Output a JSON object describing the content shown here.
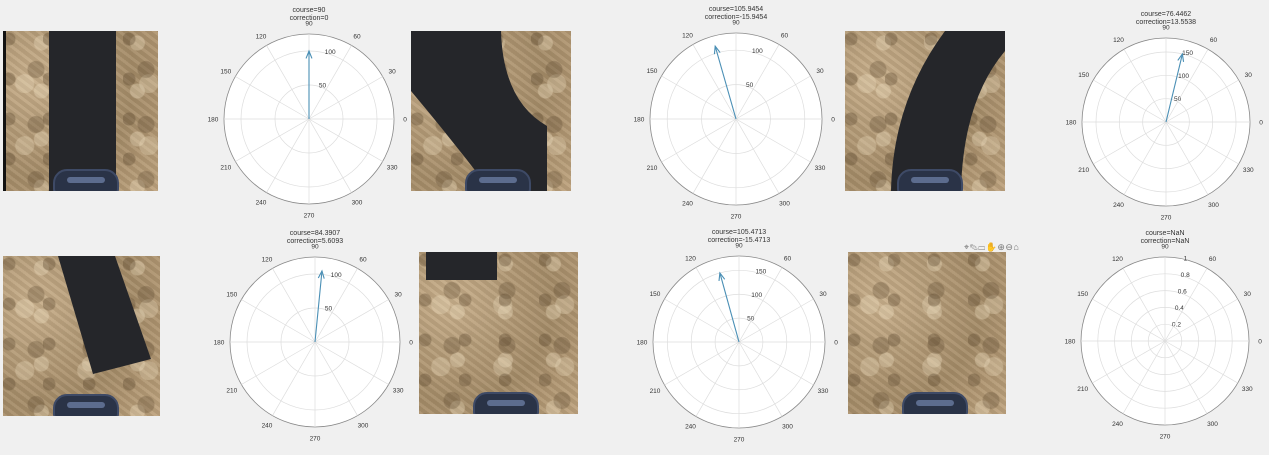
{
  "toolbar_icons": "⌖✎▭✋⊕⊖⌂",
  "plots": [
    {
      "course_label": "course=90",
      "correction_label": "correction=0",
      "radial_ticks": [
        "50",
        "100"
      ],
      "angle_deg": 90,
      "magnitude": 100,
      "rmax": 125
    },
    {
      "course_label": "course=105.9454",
      "correction_label": "correction=-15.9454",
      "radial_ticks": [
        "50",
        "100"
      ],
      "angle_deg": 105.9454,
      "magnitude": 110,
      "rmax": 125
    },
    {
      "course_label": "course=76.4462",
      "correction_label": "correction=13.5538",
      "radial_ticks": [
        "50",
        "100",
        "150"
      ],
      "angle_deg": 76.4462,
      "magnitude": 150,
      "rmax": 180
    },
    {
      "course_label": "course=84.3907",
      "correction_label": "correction=5.6093",
      "radial_ticks": [
        "50",
        "100"
      ],
      "angle_deg": 84.3907,
      "magnitude": 105,
      "rmax": 125
    },
    {
      "course_label": "course=105.4713",
      "correction_label": "correction=-15.4713",
      "radial_ticks": [
        "50",
        "100",
        "150"
      ],
      "angle_deg": 105.4713,
      "magnitude": 150,
      "rmax": 180
    },
    {
      "course_label": "course=NaN",
      "correction_label": "correction=NaN",
      "radial_ticks": [
        "0.2",
        "0.4",
        "0.6",
        "0.8",
        "1"
      ],
      "angle_deg": null,
      "magnitude": null,
      "rmax": 1
    }
  ],
  "angle_ticks": [
    "0",
    "30",
    "60",
    "90",
    "120",
    "150",
    "180",
    "210",
    "240",
    "270",
    "300",
    "330"
  ],
  "chart_data": [
    {
      "type": "polar",
      "title": "course=90",
      "subtitle": "correction=0",
      "series": [
        {
          "angle": 90,
          "r": 100
        }
      ],
      "rlim": [
        0,
        125
      ],
      "grid": true
    },
    {
      "type": "polar",
      "title": "course=105.9454",
      "subtitle": "correction=-15.9454",
      "series": [
        {
          "angle": 105.9454,
          "r": 110
        }
      ],
      "rlim": [
        0,
        125
      ],
      "grid": true
    },
    {
      "type": "polar",
      "title": "course=76.4462",
      "subtitle": "correction=13.5538",
      "series": [
        {
          "angle": 76.4462,
          "r": 150
        }
      ],
      "rlim": [
        0,
        180
      ],
      "grid": true
    },
    {
      "type": "polar",
      "title": "course=84.3907",
      "subtitle": "correction=5.6093",
      "series": [
        {
          "angle": 84.3907,
          "r": 105
        }
      ],
      "rlim": [
        0,
        125
      ],
      "grid": true
    },
    {
      "type": "polar",
      "title": "course=105.4713",
      "subtitle": "correction=-15.4713",
      "series": [
        {
          "angle": 105.4713,
          "r": 150
        }
      ],
      "rlim": [
        0,
        180
      ],
      "grid": true
    },
    {
      "type": "polar",
      "title": "course=NaN",
      "subtitle": "correction=NaN",
      "series": [],
      "rlim": [
        0,
        1
      ],
      "grid": true
    }
  ]
}
